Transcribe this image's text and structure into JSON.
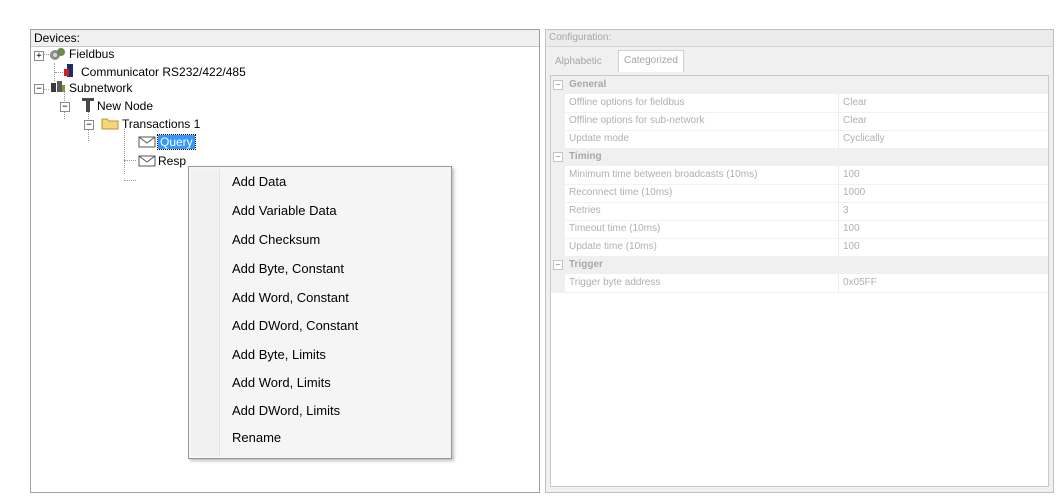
{
  "devices_panel": {
    "header": "Devices:",
    "tree": {
      "fieldbus": "Fieldbus",
      "communicator": "Communicator RS232/422/485",
      "subnetwork": "Subnetwork",
      "new_node": "New Node",
      "transactions": "Transactions 1",
      "query": "Query",
      "response": "Resp"
    },
    "expanders": {
      "plus": "+",
      "minus": "−"
    }
  },
  "config_panel": {
    "header": "Configuration:",
    "tabs": [
      "Alphabetic",
      "Categorized"
    ],
    "active_tab": "Categorized",
    "sections": [
      {
        "name": "General",
        "props": [
          {
            "key": "Offline options for fieldbus",
            "value": "Clear"
          },
          {
            "key": "Offline options for sub-network",
            "value": "Clear"
          },
          {
            "key": "Update mode",
            "value": "Cyclically"
          }
        ]
      },
      {
        "name": "Timing",
        "props": [
          {
            "key": "Minimum time between broadcasts (10ms)",
            "value": "100"
          },
          {
            "key": "Reconnect time (10ms)",
            "value": "1000"
          },
          {
            "key": "Retries",
            "value": "3"
          },
          {
            "key": "Timeout time (10ms)",
            "value": "100"
          },
          {
            "key": "Update time (10ms)",
            "value": "100"
          }
        ]
      },
      {
        "name": "Trigger",
        "props": [
          {
            "key": "Trigger byte address",
            "value": "0x05FF"
          }
        ]
      }
    ],
    "collapse_glyph": "−"
  },
  "context_menu": {
    "items": [
      "Add Data",
      "Add Variable Data",
      "Add Checksum",
      "Add Byte, Constant",
      "Add Word, Constant",
      "Add DWord, Constant",
      "Add Byte, Limits",
      "Add Word, Limits",
      "Add DWord, Limits",
      "Rename"
    ]
  },
  "colors": {
    "selection": "#3399ff",
    "folder": "#f5d77a",
    "dimmed_text": "#b0b0b0"
  },
  "icons": [
    "fieldbus-icon",
    "communicator-icon",
    "subnetwork-icon",
    "node-icon",
    "folder-icon",
    "envelope-icon"
  ]
}
